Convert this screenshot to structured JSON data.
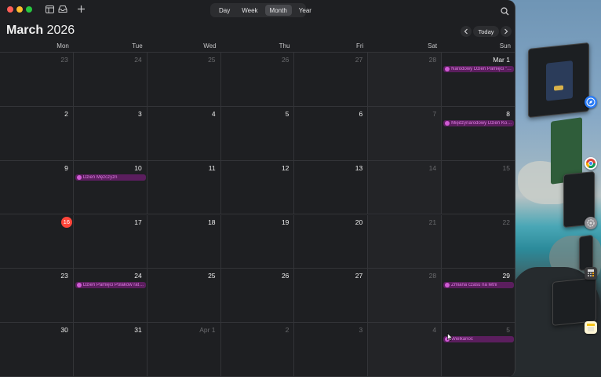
{
  "toolbar": {
    "views": [
      {
        "label": "Day",
        "active": false
      },
      {
        "label": "Week",
        "active": false
      },
      {
        "label": "Month",
        "active": true
      },
      {
        "label": "Year",
        "active": false
      }
    ],
    "add_icon": "plus-icon",
    "calendars_icon": "calendar-list-icon",
    "inbox_icon": "inbox-icon",
    "search_icon": "search-icon"
  },
  "header": {
    "month": "March",
    "year": "2026",
    "today_label": "Today"
  },
  "weekdays": [
    "Mon",
    "Tue",
    "Wed",
    "Thu",
    "Fri",
    "Sat",
    "Sun"
  ],
  "weeks": [
    [
      {
        "d": "23",
        "dim": true
      },
      {
        "d": "24",
        "dim": true
      },
      {
        "d": "25",
        "dim": true
      },
      {
        "d": "26",
        "dim": true
      },
      {
        "d": "27",
        "dim": true
      },
      {
        "d": "28",
        "dim": true
      },
      {
        "d": "Mar 1",
        "dim": false
      }
    ],
    [
      {
        "d": "2"
      },
      {
        "d": "3"
      },
      {
        "d": "4"
      },
      {
        "d": "5"
      },
      {
        "d": "6"
      },
      {
        "d": "7",
        "dim": true
      },
      {
        "d": "8"
      }
    ],
    [
      {
        "d": "9"
      },
      {
        "d": "10"
      },
      {
        "d": "11"
      },
      {
        "d": "12"
      },
      {
        "d": "13"
      },
      {
        "d": "14",
        "dim": true
      },
      {
        "d": "15",
        "dim": true
      }
    ],
    [
      {
        "d": "16",
        "today": true
      },
      {
        "d": "17"
      },
      {
        "d": "18"
      },
      {
        "d": "19"
      },
      {
        "d": "20"
      },
      {
        "d": "21",
        "dim": true
      },
      {
        "d": "22",
        "dim": true
      }
    ],
    [
      {
        "d": "23"
      },
      {
        "d": "24"
      },
      {
        "d": "25"
      },
      {
        "d": "26"
      },
      {
        "d": "27"
      },
      {
        "d": "28",
        "dim": true
      },
      {
        "d": "29"
      }
    ],
    [
      {
        "d": "30"
      },
      {
        "d": "31"
      },
      {
        "d": "Apr 1",
        "dim": true
      },
      {
        "d": "2",
        "dim": true
      },
      {
        "d": "3",
        "dim": true
      },
      {
        "d": "4",
        "dim": true
      },
      {
        "d": "5",
        "dim": true
      }
    ]
  ],
  "events": [
    {
      "week": 0,
      "day": 6,
      "label": "Narodowy Dzień Pamięci \"Żołnierzy Wyklętych\""
    },
    {
      "week": 1,
      "day": 6,
      "label": "Międzynarodowy Dzień Kobiet"
    },
    {
      "week": 2,
      "day": 1,
      "label": "Dzień Mężczyzn"
    },
    {
      "week": 4,
      "day": 1,
      "label": "Dzień Pamięci Polaków ratujących Żydów"
    },
    {
      "week": 4,
      "day": 6,
      "label": "Zmiana czasu na letni"
    },
    {
      "week": 5,
      "day": 6,
      "label": "Wielkanoc"
    }
  ],
  "colors": {
    "event_bg": "#5b1e5e",
    "event_text": "#e07ce4",
    "event_dot": "#cf5bd4",
    "today": "#ff453a"
  },
  "dock": [
    {
      "icon": "safari-icon"
    },
    {
      "icon": "chrome-icon"
    },
    {
      "icon": "system-settings-icon"
    },
    {
      "icon": "calculator-icon"
    },
    {
      "icon": "notes-icon"
    }
  ]
}
